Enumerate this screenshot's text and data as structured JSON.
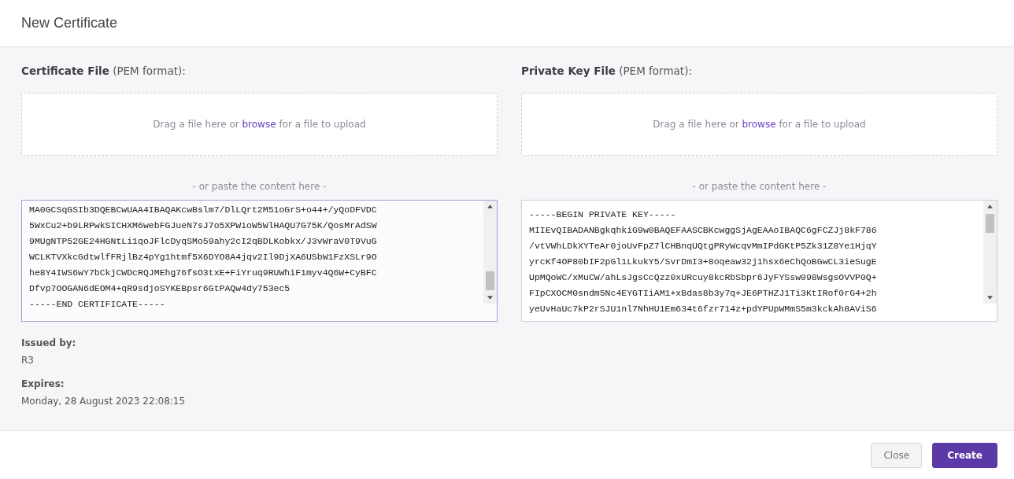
{
  "window": {
    "title": "New Certificate"
  },
  "columns": [
    {
      "label_bold": "Certificate File",
      "label_rest": "(PEM format):",
      "dropzone": {
        "before": "Drag a file here or",
        "link": "browse",
        "after": "for a file to upload"
      },
      "paste_hint": "- or paste the content here -",
      "focused": true,
      "lines": [
        "MA0GCSqGSIb3DQEBCwUAA4IBAQAKcwBslm7/DlLQrt2M51oGrS+o44+/yQoDFVDC",
        "5WxCu2+b9LRPwkSICHXM6webFGJueN7sJ7o5XPWioW5WlHAQU7G75K/QosMrAdSW",
        "9MUgNTP52GE24HGNtLi1qoJFlcDyqSMo59ahy2cI2qBDLKobkx/J3vWraV0T9VuG",
        "WCLKTVXkcGdtwlfFRjlBz4pYg1htmf5X6DYO8A4jqv2Il9DjXA6USbW1FzXSLr9O",
        "he8Y4IWS6wY7bCkjCWDcRQJMEhg76fsO3txE+FiYruq9RUWhiF1myv4Q6W+CyBFC",
        "Dfvp7OOGAN6dEOM4+qR9sdjoSYKEBpsr6GtPAQw4dy753ec5",
        "-----END CERTIFICATE-----"
      ]
    },
    {
      "label_bold": "Private Key File",
      "label_rest": "(PEM format):",
      "dropzone": {
        "before": "Drag a file here or",
        "link": "browse",
        "after": "for a file to upload"
      },
      "paste_hint": "- or paste the content here -",
      "focused": false,
      "lines": [
        "-----BEGIN PRIVATE KEY-----",
        "MIIEvQIBADANBgkqhkiG9w0BAQEFAASCBKcwggSjAgEAAoIBAQC6gFCZJj8kF786",
        "/vtVWhLDkXYTeAr0joUvFpZ7lCHBnqUQtgPRyWcqvMmIPdGKtP5Zk31Z8Ye1HjqY",
        "yrcKf4OP80bIF2pGl1LkukY5/SvrDmI3+8oqeaw32j1hsx6eChQoBGwCL3ieSugE",
        "UpMQoWC/xMuCW/ahLsJgsCcQzz0xURcuy8kcRbSbpr6JyFYSsw098WsgsOVVP0Q+",
        "FIpCXOCM0sndm5Nc4EYGTIiAM1+xBdas8b3y7q+JE6PTHZJ1Ti3KtIRof0rG4+2h",
        "yeUvHaUc7kP2rSJU1nl7NhHU1Em634t6fzr714z+pdYPUpWMmS5m3kckAh8AViS6"
      ]
    }
  ],
  "details": [
    {
      "label": "Issued by:",
      "value": "R3"
    },
    {
      "label": "Expires:",
      "value": "Monday, 28 August 2023 22:08:15"
    }
  ],
  "buttons": [
    {
      "label": "Close",
      "kind": "secondary"
    },
    {
      "label": "Create",
      "kind": "primary"
    }
  ]
}
